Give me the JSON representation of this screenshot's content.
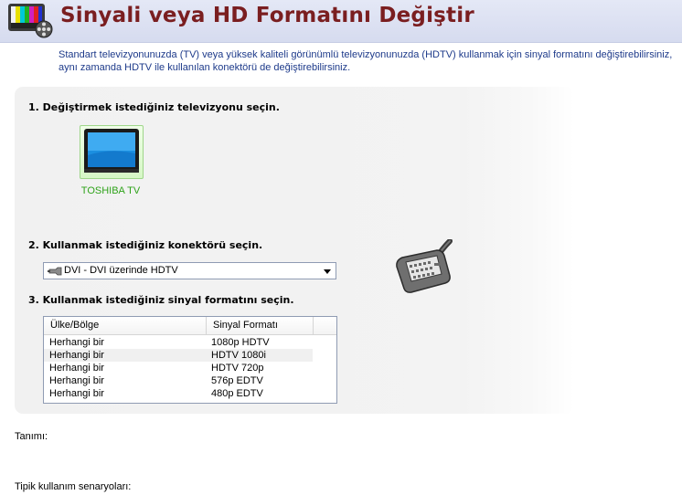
{
  "header": {
    "title": "Sinyali veya HD Formatını Değiştir",
    "icon": "tv-color-bars-film-reel-icon"
  },
  "description": "Standart televizyonunuzda (TV) veya yüksek kaliteli görünümlü televizyonunuzda (HDTV) kullanmak için sinyal formatını değiştirebilirsiniz, aynı zamanda HDTV ile kullanılan konektörü de değiştirebilirsiniz.",
  "step1": {
    "label": "1. Değiştirmek istediğiniz televizyonu seçin.",
    "tv_name": "TOSHIBA TV",
    "tv_label_color": "#2fa31a"
  },
  "step2": {
    "label": "2. Kullanmak istediğiniz konektörü seçin.",
    "selected": "DVI - DVI üzerinde HDTV",
    "icon": "dvi-connector-icon"
  },
  "step3": {
    "label": "3. Kullanmak istediğiniz sinyal formatını seçin.",
    "columns": [
      "Ülke/Bölge",
      "Sinyal Formatı"
    ],
    "rows": [
      {
        "region": "Herhangi bir",
        "format": "1080p HDTV"
      },
      {
        "region": "Herhangi bir",
        "format": "HDTV 1080i"
      },
      {
        "region": "Herhangi bir",
        "format": "HDTV 720p"
      },
      {
        "region": "Herhangi bir",
        "format": "576p EDTV"
      },
      {
        "region": "Herhangi bir",
        "format": "480p EDTV"
      }
    ],
    "selected_index": 1
  },
  "footer": {
    "description_label": "Tanımı:",
    "scenarios_label": "Tipik kullanım senaryoları:"
  },
  "colors": {
    "title": "#7a1e20",
    "description": "#1d3a8a",
    "panel": "#f1f1f1"
  }
}
